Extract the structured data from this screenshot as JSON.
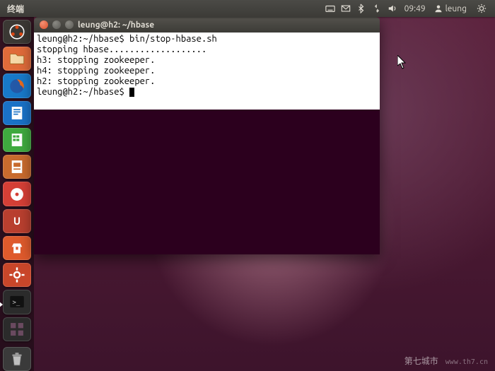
{
  "panel": {
    "app_label": "终端",
    "clock": "09:49",
    "username": "leung"
  },
  "launcher": {
    "items": [
      {
        "name": "dash",
        "bg": "#3b3834"
      },
      {
        "name": "files",
        "bg": "#e06b3a"
      },
      {
        "name": "firefox",
        "bg": "#1879c9"
      },
      {
        "name": "writer",
        "bg": "#1a72c7"
      },
      {
        "name": "calc",
        "bg": "#3faa3f"
      },
      {
        "name": "impress",
        "bg": "#c96b2e"
      },
      {
        "name": "media",
        "bg": "#d53f36"
      },
      {
        "name": "ubuntu-one",
        "bg": "#b93f2f"
      },
      {
        "name": "software-center",
        "bg": "#df5a2c"
      },
      {
        "name": "settings",
        "bg": "#c9462a"
      },
      {
        "name": "terminal",
        "bg": "#2b2b2b",
        "running": true
      },
      {
        "name": "workspace",
        "bg": "#2b2b2b"
      }
    ],
    "trash_name": "trash"
  },
  "terminal": {
    "title": "leung@h2: ~/hbase",
    "lines": [
      "leung@h2:~/hbase$ bin/stop-hbase.sh",
      "stopping hbase...................",
      "h3: stopping zookeeper.",
      "h4: stopping zookeeper.",
      "h2: stopping zookeeper.",
      "leung@h2:~/hbase$ "
    ]
  },
  "watermark": {
    "text": "第七城市",
    "url": "www.th7.cn"
  }
}
